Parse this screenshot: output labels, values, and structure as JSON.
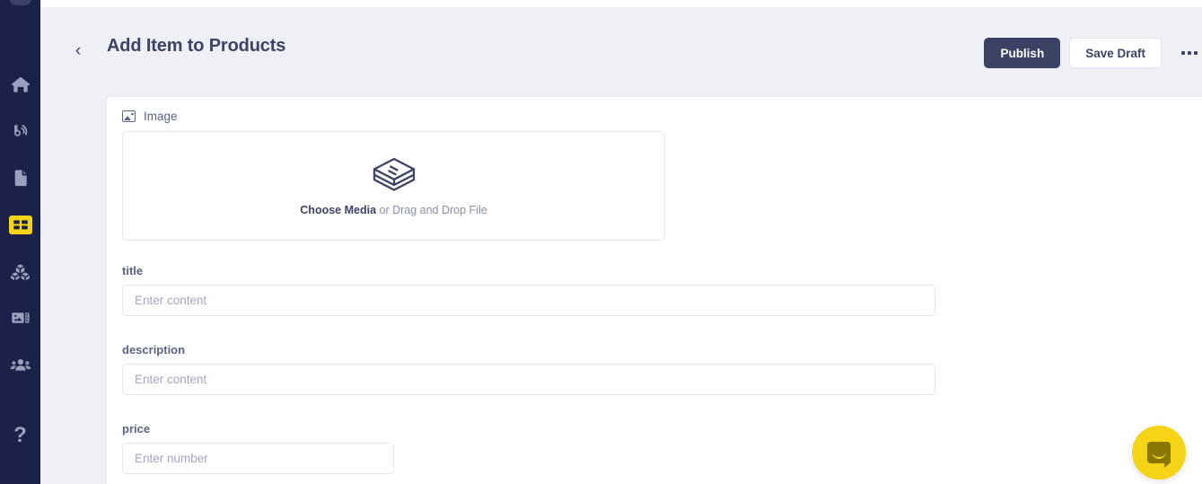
{
  "sidebar": {
    "logo": "brand-logo",
    "items": [
      {
        "name": "home",
        "icon": "home-icon",
        "active": false
      },
      {
        "name": "broadcast",
        "icon": "broadcast-icon",
        "active": false
      },
      {
        "name": "pages",
        "icon": "document-icon",
        "active": false
      },
      {
        "name": "tables",
        "icon": "table-grid-icon",
        "active": true
      },
      {
        "name": "models",
        "icon": "cubes-icon",
        "active": false
      },
      {
        "name": "media",
        "icon": "media-icon",
        "active": false
      },
      {
        "name": "users",
        "icon": "users-icon",
        "active": false
      }
    ],
    "help": "?",
    "active_color": "#f5d316",
    "bg_color": "#1b2149",
    "icon_color": "#9aa0bd"
  },
  "header": {
    "back_label": "‹",
    "title": "Add Item to Products",
    "publish_label": "Publish",
    "save_draft_label": "Save Draft",
    "more_label": "more-options",
    "publish_color": "#3b4264"
  },
  "form": {
    "image": {
      "label": "Image",
      "icon": "image-icon",
      "dropzone_icon": "stacked-layers-icon",
      "cta": "Choose Media",
      "cta_suffix": " or Drag and Drop File"
    },
    "fields": [
      {
        "label": "title",
        "value": "",
        "placeholder": "Enter content"
      },
      {
        "label": "description",
        "value": "",
        "placeholder": "Enter content"
      },
      {
        "label": "price",
        "value": "",
        "placeholder": "Enter number"
      }
    ]
  },
  "intercom": {
    "label": "open-messenger",
    "color": "#f5d316"
  }
}
